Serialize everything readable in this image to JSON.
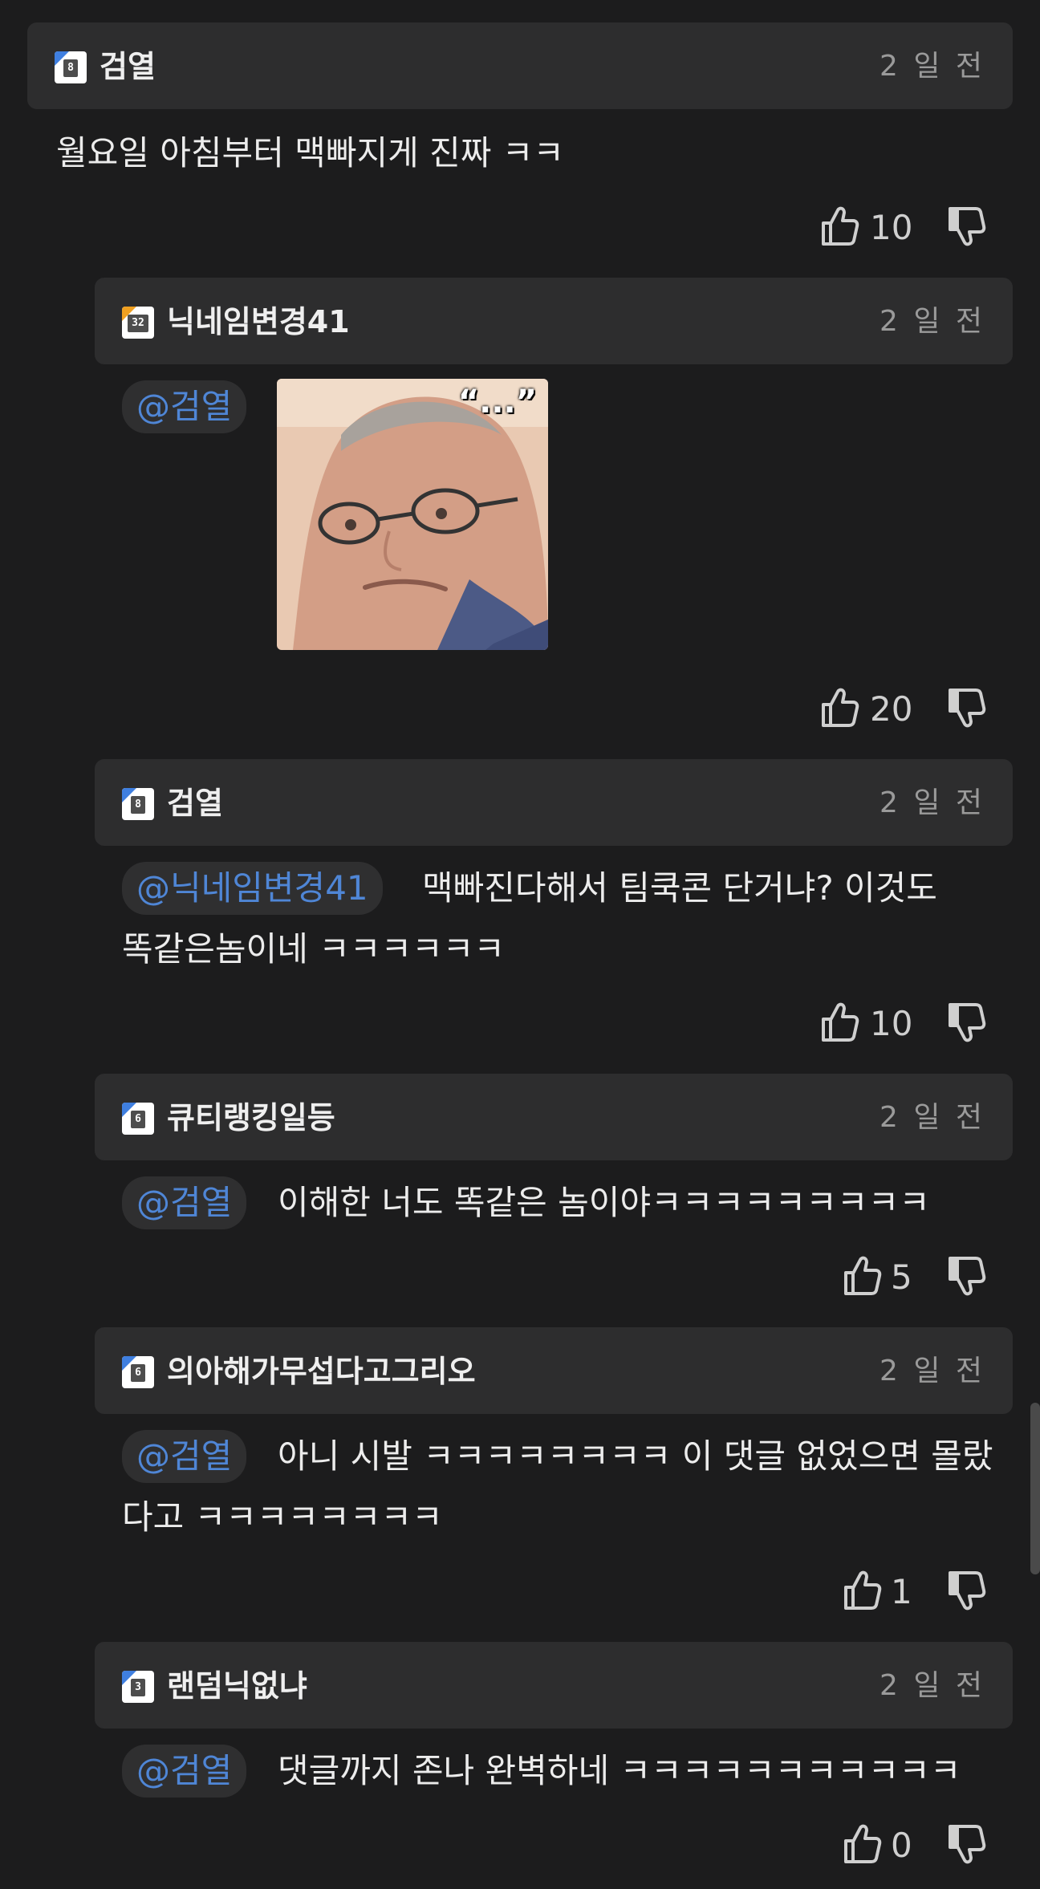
{
  "comments": [
    {
      "user": "검열",
      "level": "8",
      "time": "2 일 전",
      "text": "월요일 아침부터 맥빠지게 진짜 ㅋㅋ",
      "likes": "10"
    },
    {
      "user": "닉네임변경41",
      "level": "32",
      "time": "2 일 전",
      "mention": "@검열",
      "likes": "20"
    },
    {
      "user": "검열",
      "level": "8",
      "time": "2 일 전",
      "mention": "@닉네임변경41",
      "text_line1": "맥빠진다해서 팀쿡콘 단거냐? 이것도",
      "text_line2": "똑같은놈이네 ㅋㅋㅋㅋㅋㅋ",
      "likes": "10"
    },
    {
      "user": "큐티랭킹일등",
      "level": "6",
      "time": "2 일 전",
      "mention": "@검열",
      "text_line1": "이해한 너도 똑같은 놈이야ㅋㅋㅋㅋㅋㅋㅋㅋㅋ",
      "likes": "5"
    },
    {
      "user": "의아해가무섭다고그리오",
      "level": "6",
      "time": "2 일 전",
      "mention": "@검열",
      "text_line1": "아니 시발 ㅋㅋㅋㅋㅋㅋㅋㅋ 이 댓글 없었으면 몰랐",
      "text_line2": "다고 ㅋㅋㅋㅋㅋㅋㅋㅋ",
      "likes": "1"
    },
    {
      "user": "랜덤닉없냐",
      "level": "3",
      "time": "2 일 전",
      "mention": "@검열",
      "text_line1": "댓글까지 존나 완벽하네 ㅋㅋㅋㅋㅋㅋㅋㅋㅋㅋㅋ",
      "likes": "0"
    }
  ],
  "sticker": {
    "caption": "“...”"
  },
  "colors": {
    "background": "#1c1c1d",
    "header_bar": "#2d2d2e",
    "mention_text": "#4f86d6",
    "time_text": "#9a9a9a"
  },
  "icons": {
    "like": "thumbs-up-icon",
    "dislike": "thumbs-down-icon",
    "level_badge": "level-badge-icon"
  }
}
